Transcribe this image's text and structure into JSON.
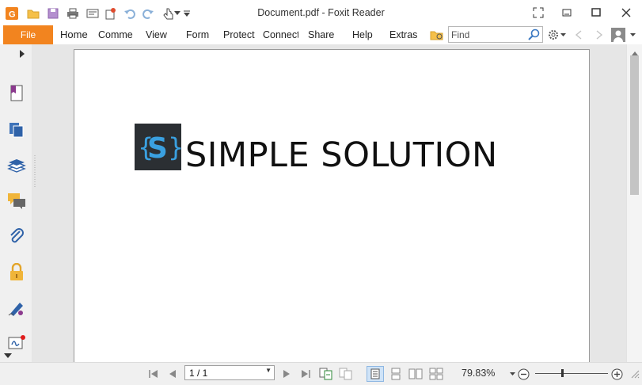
{
  "window": {
    "title": "Document.pdf - Foxit Reader"
  },
  "quick_access": [
    {
      "name": "foxit-logo-icon"
    },
    {
      "name": "open-folder-icon"
    },
    {
      "name": "save-icon"
    },
    {
      "name": "print-icon"
    },
    {
      "name": "properties-icon"
    },
    {
      "name": "new-icon"
    },
    {
      "name": "undo-icon"
    },
    {
      "name": "redo-icon"
    },
    {
      "name": "hand-tool-icon"
    },
    {
      "name": "customize-arrow-icon"
    }
  ],
  "menu": {
    "file": "File",
    "tabs": [
      "Home",
      "Comme",
      "View",
      "Form",
      "Protect",
      "Connect",
      "Share",
      "Help",
      "Extras"
    ]
  },
  "search": {
    "placeholder": "Find"
  },
  "left_panel": [
    {
      "name": "bookmark-icon"
    },
    {
      "name": "pages-icon"
    },
    {
      "name": "layers-icon"
    },
    {
      "name": "comments-icon"
    },
    {
      "name": "attachments-icon"
    },
    {
      "name": "security-lock-icon"
    },
    {
      "name": "signature-icon"
    },
    {
      "name": "digital-signature-icon"
    }
  ],
  "document": {
    "logo_letter": "S",
    "logo_braces": "{ }",
    "heading": "SIMPLE SOLUTION"
  },
  "status_bar": {
    "page_indicator": "1 / 1",
    "zoom": "79.83%"
  },
  "colors": {
    "file_tab": "#f2841f",
    "logo_bg": "#2b2f33",
    "logo_accent": "#3aa0e0"
  }
}
